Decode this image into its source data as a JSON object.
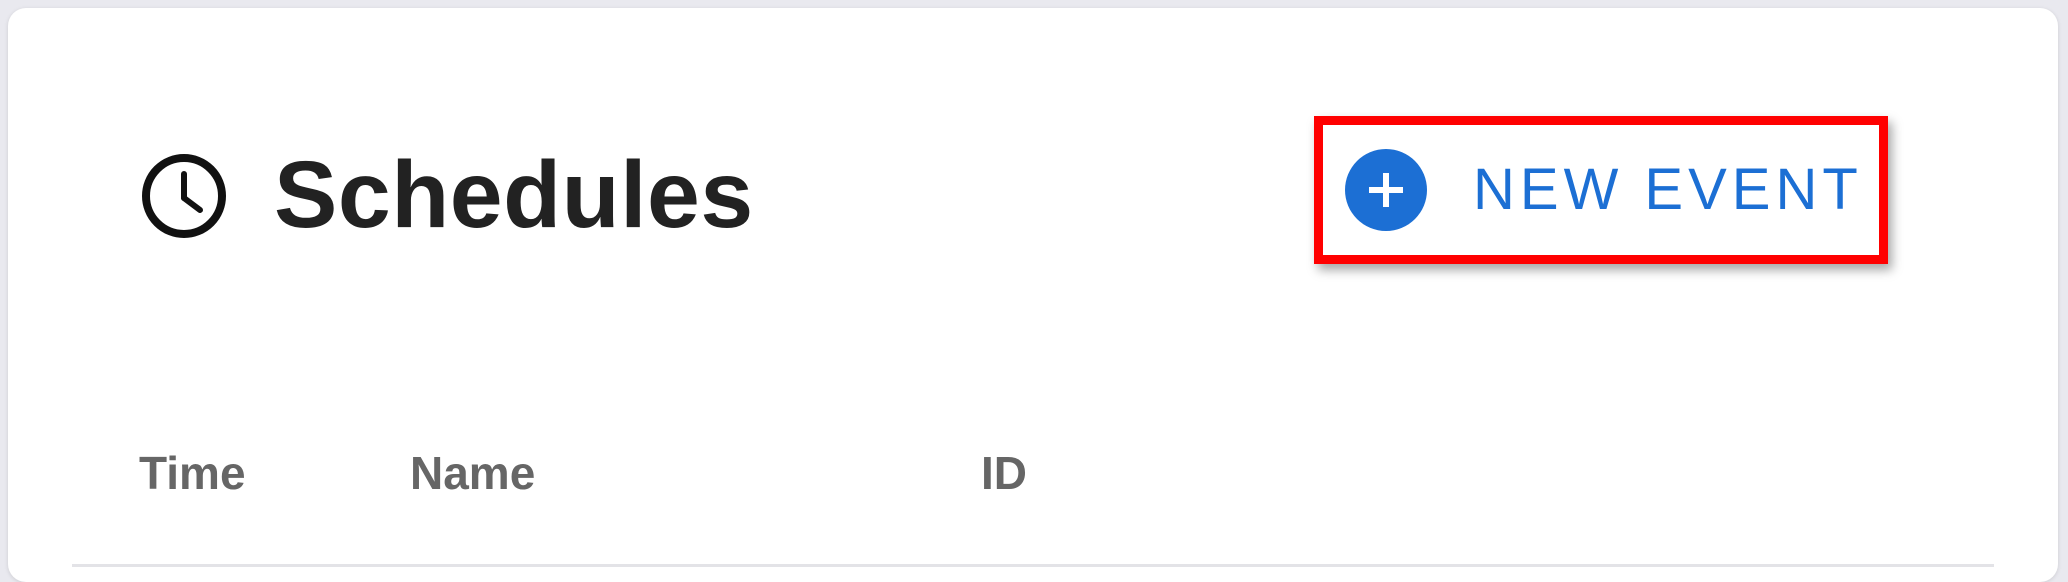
{
  "colors": {
    "accent": "#1c6fd4",
    "title": "#222222",
    "column_header": "#666666",
    "highlight_border": "#ff0000"
  },
  "header": {
    "icon": "clock-icon",
    "title": "Schedules"
  },
  "new_event_button": {
    "icon": "plus-circle-icon",
    "label": "NEW EVENT"
  },
  "table": {
    "columns": [
      "Time",
      "Name",
      "ID"
    ]
  }
}
